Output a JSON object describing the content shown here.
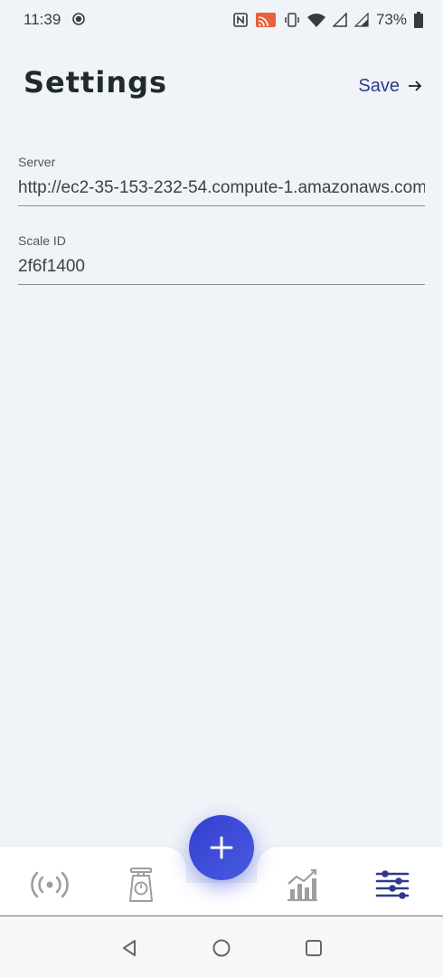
{
  "status_bar": {
    "time": "11:39",
    "battery_percent": "73%",
    "icons": [
      "record-icon",
      "nfc-icon",
      "cast-icon",
      "vibrate-icon",
      "wifi-icon",
      "signal-icon",
      "signal-icon",
      "battery-icon"
    ]
  },
  "header": {
    "title": "Settings",
    "save_label": "Save"
  },
  "fields": {
    "server": {
      "label": "Server",
      "value": "http://ec2-35-153-232-54.compute-1.amazonaws.com"
    },
    "scale_id": {
      "label": "Scale ID",
      "value": "2f6f1400"
    }
  },
  "bottom_nav": {
    "items": [
      {
        "icon": "broadcast-icon",
        "active": false
      },
      {
        "icon": "scale-icon",
        "active": false
      },
      {
        "icon": "add-icon",
        "active": false
      },
      {
        "icon": "chart-icon",
        "active": false
      },
      {
        "icon": "settings-sliders-icon",
        "active": true
      }
    ]
  },
  "colors": {
    "background": "#f0f3f7",
    "accent": "#2d3a8c",
    "fab": "#3f4bd6",
    "cast_icon": "#e8603c",
    "inactive_icon": "#9e9e9e"
  }
}
